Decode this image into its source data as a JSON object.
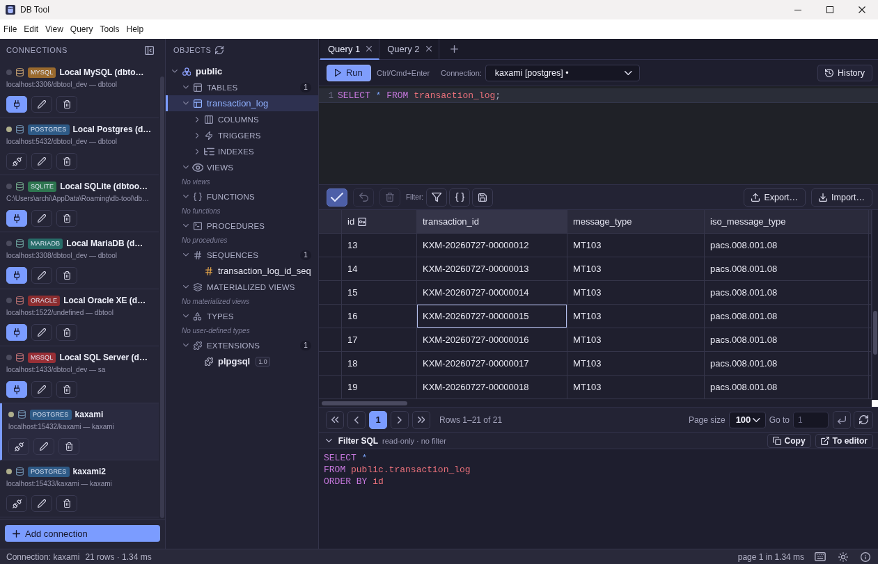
{
  "window": {
    "title": "DB Tool"
  },
  "menu": [
    "File",
    "Edit",
    "View",
    "Query",
    "Tools",
    "Help"
  ],
  "connections_panel": {
    "title": "CONNECTIONS",
    "connections": [
      {
        "badge": "MYSQL",
        "color": "#9a6a2e",
        "name": "Local MySQL (dbto…",
        "address": "localhost:3306/dbtool_dev — dbtool",
        "connected": false,
        "selected": false
      },
      {
        "badge": "POSTGRES",
        "color": "#2e5a86",
        "name": "Local Postgres (d…",
        "address": "localhost:5432/dbtool_dev — dbtool",
        "connected": true,
        "selected": false
      },
      {
        "badge": "SQLITE",
        "color": "#2e7650",
        "name": "Local SQLite (dbtoo…",
        "address": "C:\\Users\\archi\\AppData\\Roaming\\db-tool\\db…",
        "connected": false,
        "selected": false
      },
      {
        "badge": "MARIADB",
        "color": "#276c68",
        "name": "Local MariaDB (d…",
        "address": "localhost:3308/dbtool_dev — dbtool",
        "connected": false,
        "selected": false
      },
      {
        "badge": "ORACLE",
        "color": "#8c2d2f",
        "name": "Local Oracle XE (d…",
        "address": "localhost:1522/undefined — dbtool",
        "connected": false,
        "selected": false
      },
      {
        "badge": "MSSQL",
        "color": "#982f36",
        "name": "Local SQL Server (d…",
        "address": "localhost:1433/dbtool_dev — sa",
        "connected": false,
        "selected": false
      },
      {
        "badge": "POSTGRES",
        "color": "#2e5a86",
        "name": "kaxami",
        "address": "localhost:15432/kaxami — kaxami",
        "connected": true,
        "selected": true
      },
      {
        "badge": "POSTGRES",
        "color": "#2e5a86",
        "name": "kaxami2",
        "address": "localhost:15433/kaxami — kaxami",
        "connected": true,
        "selected": false
      }
    ],
    "add_button": "Add connection"
  },
  "objects_panel": {
    "title": "OBJECTS",
    "tree": [
      {
        "kind": "schema",
        "label": "public",
        "expanded": true,
        "selected": false,
        "children": [
          {
            "kind": "tables",
            "label": "TABLES",
            "count": "1",
            "expanded": true,
            "selected": false,
            "children": [
              {
                "kind": "table",
                "label": "transaction_log",
                "expanded": true,
                "selected": true,
                "children": [
                  {
                    "kind": "columns",
                    "label": "COLUMNS",
                    "expanded": false,
                    "selected": false
                  },
                  {
                    "kind": "triggers",
                    "label": "TRIGGERS",
                    "expanded": false,
                    "selected": false
                  },
                  {
                    "kind": "indexes",
                    "label": "INDEXES",
                    "expanded": false,
                    "selected": false
                  }
                ]
              }
            ]
          },
          {
            "kind": "views",
            "label": "VIEWS",
            "expanded": true,
            "selected": false,
            "note": "No views"
          },
          {
            "kind": "functions",
            "label": "FUNCTIONS",
            "expanded": true,
            "selected": false,
            "note": "No functions"
          },
          {
            "kind": "procedures",
            "label": "PROCEDURES",
            "expanded": true,
            "selected": false,
            "note": "No procedures"
          },
          {
            "kind": "sequences",
            "label": "SEQUENCES",
            "count": "1",
            "expanded": true,
            "selected": false,
            "children": [
              {
                "kind": "sequence",
                "label": "transaction_log_id_seq",
                "selected": false
              }
            ]
          },
          {
            "kind": "matviews",
            "label": "MATERIALIZED VIEWS",
            "expanded": true,
            "selected": false,
            "note": "No materialized views"
          },
          {
            "kind": "types",
            "label": "TYPES",
            "expanded": true,
            "selected": false,
            "note": "No user-defined types"
          },
          {
            "kind": "extensions",
            "label": "EXTENSIONS",
            "count": "1",
            "expanded": true,
            "selected": false,
            "children": [
              {
                "kind": "extension",
                "label": "plpgsql",
                "version": "1.0",
                "selected": false
              }
            ]
          }
        ]
      }
    ]
  },
  "query_tabs": [
    {
      "label": "Query 1",
      "selected": true
    },
    {
      "label": "Query 2",
      "selected": false
    }
  ],
  "query_toolbar": {
    "run_label": "Run",
    "shortcut": "Ctrl/Cmd+Enter",
    "connection_label": "Connection:",
    "connection_value": "kaxami [postgres] •",
    "history_label": "History"
  },
  "editor": {
    "lines": [
      {
        "number": "1",
        "active": true,
        "tokens": [
          {
            "kind": "keyword",
            "text": "SELECT "
          },
          {
            "kind": "operator",
            "text": "* "
          },
          {
            "kind": "keyword",
            "text": "FROM "
          },
          {
            "kind": "identifier",
            "text": "transaction_log"
          },
          {
            "kind": "punctuation",
            "text": ";"
          }
        ]
      }
    ]
  },
  "grid_toolbar": {
    "edit_buttons": [
      {
        "kind": "apply",
        "disabled": false
      },
      {
        "kind": "undo",
        "disabled": true
      },
      {
        "kind": "delete",
        "disabled": true
      }
    ],
    "filter_label": "Filter:",
    "export_label": "Export…",
    "import_label": "Import…"
  },
  "table": {
    "columns": [
      {
        "label": "id",
        "primary_key": true,
        "selected": false
      },
      {
        "label": "transaction_id",
        "primary_key": false,
        "selected": true
      },
      {
        "label": "message_type",
        "primary_key": false,
        "selected": false
      },
      {
        "label": "iso_message_type",
        "primary_key": false,
        "selected": false
      }
    ],
    "rows": [
      {
        "cells": [
          "13",
          "KXM-20260727-00000012",
          "MT103",
          "pacs.008.001.08"
        ],
        "selected": false
      },
      {
        "cells": [
          "14",
          "KXM-20260727-00000013",
          "MT103",
          "pacs.008.001.08"
        ],
        "selected": false
      },
      {
        "cells": [
          "15",
          "KXM-20260727-00000014",
          "MT103",
          "pacs.008.001.08"
        ],
        "selected": false
      },
      {
        "cells": [
          "16",
          "KXM-20260727-00000015",
          "MT103",
          "pacs.008.001.08"
        ],
        "selected": true
      },
      {
        "cells": [
          "17",
          "KXM-20260727-00000016",
          "MT103",
          "pacs.008.001.08"
        ],
        "selected": false
      },
      {
        "cells": [
          "18",
          "KXM-20260727-00000017",
          "MT103",
          "pacs.008.001.08"
        ],
        "selected": false
      },
      {
        "cells": [
          "19",
          "KXM-20260727-00000018",
          "MT103",
          "pacs.008.001.08"
        ],
        "selected": false
      }
    ]
  },
  "pager": {
    "pages": [
      {
        "label": "1",
        "selected": true
      }
    ],
    "summary": "Rows 1–21 of 21",
    "page_size": {
      "label": "Page size",
      "value": "100"
    },
    "goto": {
      "label": "Go to",
      "placeholder": "1"
    }
  },
  "filter_sql": {
    "title": "Filter SQL",
    "expanded": true,
    "note": "read-only · no filter",
    "copy_label": "Copy",
    "to_editor_label": "To editor",
    "lines": [
      {
        "tokens": [
          {
            "kind": "keyword",
            "text": "SELECT "
          },
          {
            "kind": "operator",
            "text": "*"
          }
        ]
      },
      {
        "tokens": [
          {
            "kind": "keyword",
            "text": "FROM "
          },
          {
            "kind": "identifier",
            "text": "public.transaction_log"
          }
        ]
      },
      {
        "tokens": [
          {
            "kind": "keyword",
            "text": "ORDER BY "
          },
          {
            "kind": "identifier",
            "text": "id"
          }
        ]
      }
    ]
  },
  "status_bar": {
    "connection": "Connection: kaxami",
    "stats": "21 rows · 1.34 ms",
    "page_info": "page 1 in 1.34 ms"
  }
}
